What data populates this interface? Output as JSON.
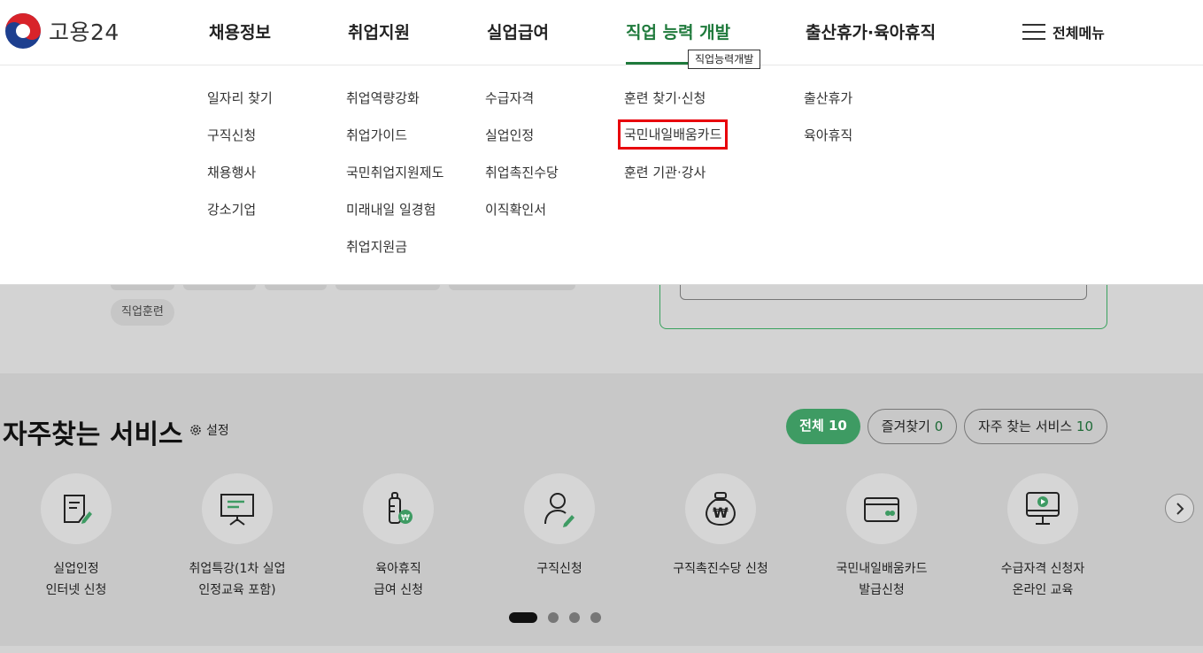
{
  "header": {
    "logo_text": "고용24",
    "nav": [
      "채용정보",
      "취업지원",
      "실업급여",
      "직업 능력 개발",
      "출산휴가·육아휴직"
    ],
    "active_tooltip": "직업능력개발",
    "all_menu_label": "전체메뉴"
  },
  "mega_menu": {
    "col1": [
      "일자리 찾기",
      "구직신청",
      "채용행사",
      "강소기업"
    ],
    "col2": [
      "취업역량강화",
      "취업가이드",
      "국민취업지원제도",
      "미래내일 일경험",
      "취업지원금"
    ],
    "col3": [
      "수급자격",
      "실업인정",
      "취업촉진수당",
      "이직확인서"
    ],
    "col4": [
      "훈련 찾기·신청",
      "국민내일배움카드",
      "훈련 기관·강사"
    ],
    "col5": [
      "출산휴가",
      "육아휴직"
    ]
  },
  "background": {
    "tag": "직업훈련"
  },
  "services": {
    "title": "자주찾는 서비스",
    "setting_label": "설정",
    "filters": [
      {
        "label": "전체",
        "count": "10"
      },
      {
        "label": "즐겨찾기",
        "count": "0"
      },
      {
        "label": "자주 찾는 서비스",
        "count": "10"
      }
    ],
    "items": [
      {
        "line1": "실업인정",
        "line2": "인터넷 신청",
        "icon": "document-pen-icon"
      },
      {
        "line1": "취업특강(1차 실업",
        "line2": "인정교육 포함)",
        "icon": "presentation-board-icon"
      },
      {
        "line1": "육아휴직",
        "line2": "급여 신청",
        "icon": "baby-bottle-won-icon"
      },
      {
        "line1": "구직신청",
        "line2": "",
        "icon": "person-pen-icon"
      },
      {
        "line1": "구직촉진수당 신청",
        "line2": "",
        "icon": "money-bag-won-icon"
      },
      {
        "line1": "국민내일배움카드",
        "line2": "발급신청",
        "icon": "card-icon"
      },
      {
        "line1": "수급자격 신청자",
        "line2": "온라인 교육",
        "icon": "monitor-play-icon"
      }
    ]
  },
  "colors": {
    "brand_green": "#1f7a3c",
    "chip_green": "#3e9b63",
    "highlight_red": "#e8000b"
  }
}
